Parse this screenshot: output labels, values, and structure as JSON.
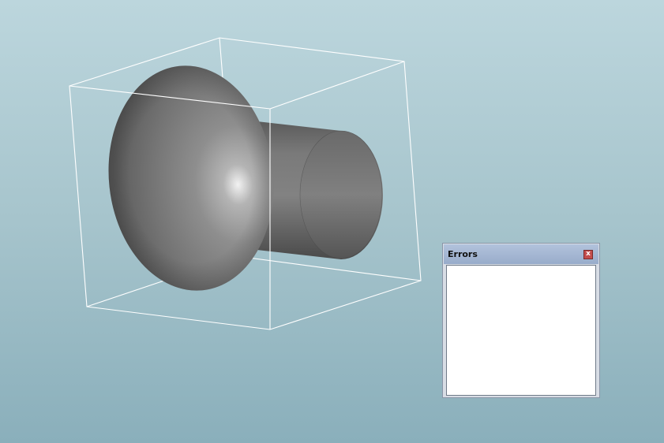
{
  "errors_panel": {
    "title": "Errors",
    "close_label": "x"
  }
}
